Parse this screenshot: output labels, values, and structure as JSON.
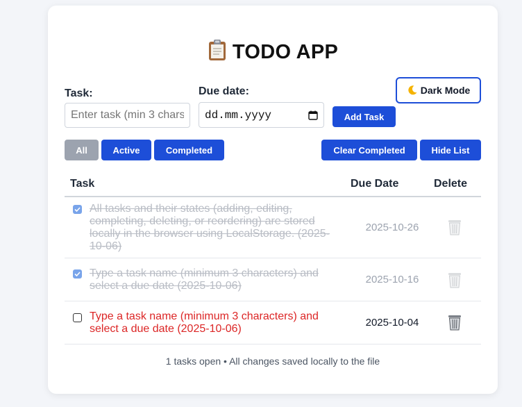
{
  "app": {
    "title": "TODO APP",
    "title_icon": "clipboard-icon",
    "dark_mode_icon": "moon-icon",
    "dark_mode_label": "Dark Mode"
  },
  "form": {
    "task_label": "Task:",
    "task_placeholder": "Enter task (min 3 chars)",
    "task_value": "",
    "due_label": "Due date:",
    "due_value": "dd.mm.yyyy",
    "calendar_icon": "calendar-icon",
    "add_button": "Add Task"
  },
  "filters": {
    "all": "All",
    "active": "Active",
    "completed": "Completed",
    "selected": "All",
    "clear_completed": "Clear Completed",
    "hide_list": "Hide List"
  },
  "table": {
    "columns": [
      "Task",
      "Due Date",
      "Delete"
    ],
    "rows": [
      {
        "checked": true,
        "text": "All tasks and their states (adding, editing, completing, deleting, or reordering) are stored locally in the browser using LocalStorage. (2025-10-06)",
        "due": "2025-10-26",
        "delete_icon": "trash-icon"
      },
      {
        "checked": true,
        "text": "Type a task name (minimum 3 characters) and select a due date (2025-10-06)",
        "due": "2025-10-16",
        "delete_icon": "trash-icon"
      },
      {
        "checked": false,
        "text": "Type a task name (minimum 3 characters) and select a due date (2025-10-06)",
        "due": "2025-10-04",
        "delete_icon": "trash-icon"
      }
    ]
  },
  "footer": {
    "status": "1 tasks open • All changes saved locally to the file"
  },
  "colors": {
    "primary": "#1d4ed8",
    "overdue_text": "#dc2626",
    "completed_text": "#b8bcc4",
    "selected_filter": "#9ca3af"
  }
}
